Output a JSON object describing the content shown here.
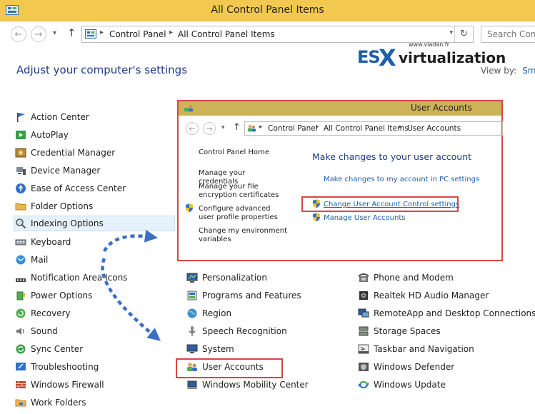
{
  "window": {
    "title": "All Control Panel Items"
  },
  "nav": {
    "breadcrumbs": [
      "Control Panel",
      "All Control Panel Items"
    ],
    "search_placeholder": "Search Contr"
  },
  "header": {
    "heading": "Adjust your computer's settings",
    "view_by_label": "View by:",
    "view_by_value": "Sma"
  },
  "logo": {
    "domain": "www.vladan.fr",
    "es": "ES",
    "x": "X",
    "virt": "virtualization"
  },
  "colors": {
    "accent": "#1e5fa8",
    "highlight_box": "#d94545",
    "titlebar": "#f2c94e"
  },
  "left_items": [
    {
      "label": "Action Center",
      "icon": "flag-icon"
    },
    {
      "label": "AutoPlay",
      "icon": "autoplay-icon"
    },
    {
      "label": "Credential Manager",
      "icon": "vault-icon"
    },
    {
      "label": "Device Manager",
      "icon": "device-icon"
    },
    {
      "label": "Ease of Access Center",
      "icon": "accessibility-icon"
    },
    {
      "label": "Folder Options",
      "icon": "folder-icon"
    },
    {
      "label": "Indexing Options",
      "icon": "magnifier-icon"
    },
    {
      "label": "Keyboard",
      "icon": "keyboard-icon"
    },
    {
      "label": "Mail",
      "icon": "mail-icon"
    },
    {
      "label": "Notification Area Icons",
      "icon": "notification-icon"
    },
    {
      "label": "Power Options",
      "icon": "power-icon"
    },
    {
      "label": "Recovery",
      "icon": "recovery-icon"
    },
    {
      "label": "Sound",
      "icon": "speaker-icon"
    },
    {
      "label": "Sync Center",
      "icon": "sync-icon"
    },
    {
      "label": "Troubleshooting",
      "icon": "troubleshoot-icon"
    },
    {
      "label": "Windows Firewall",
      "icon": "firewall-icon"
    },
    {
      "label": "Work Folders",
      "icon": "work-folder-icon"
    }
  ],
  "middle_items": [
    {
      "label": "Personalization",
      "icon": "personalization-icon"
    },
    {
      "label": "Programs and Features",
      "icon": "programs-icon"
    },
    {
      "label": "Region",
      "icon": "globe-icon"
    },
    {
      "label": "Speech Recognition",
      "icon": "microphone-icon"
    },
    {
      "label": "System",
      "icon": "monitor-icon"
    },
    {
      "label": "User Accounts",
      "icon": "users-icon"
    },
    {
      "label": "Windows Mobility Center",
      "icon": "mobility-icon"
    }
  ],
  "right_items": [
    {
      "label": "Phone and Modem",
      "icon": "phone-icon"
    },
    {
      "label": "Realtek HD Audio Manager",
      "icon": "audio-icon"
    },
    {
      "label": "RemoteApp and Desktop Connections",
      "icon": "remote-icon"
    },
    {
      "label": "Storage Spaces",
      "icon": "storage-icon"
    },
    {
      "label": "Taskbar and Navigation",
      "icon": "taskbar-icon"
    },
    {
      "label": "Windows Defender",
      "icon": "defender-icon"
    },
    {
      "label": "Windows Update",
      "icon": "update-icon"
    }
  ],
  "overlay": {
    "title": "User Accounts",
    "breadcrumbs": [
      "Control Panel",
      "All Control Panel Items",
      "User Accounts"
    ],
    "home_link": "Control Panel Home",
    "left_links": [
      "Manage your credentials",
      "Manage your file encryption certificates",
      "Configure advanced user profile properties",
      "Change my environment variables"
    ],
    "main_title": "Make changes to your user account",
    "pc_settings_link": "Make changes to my account in PC settings",
    "uac_link": "Change User Account Control settings",
    "manage_link": "Manage User Accounts"
  }
}
